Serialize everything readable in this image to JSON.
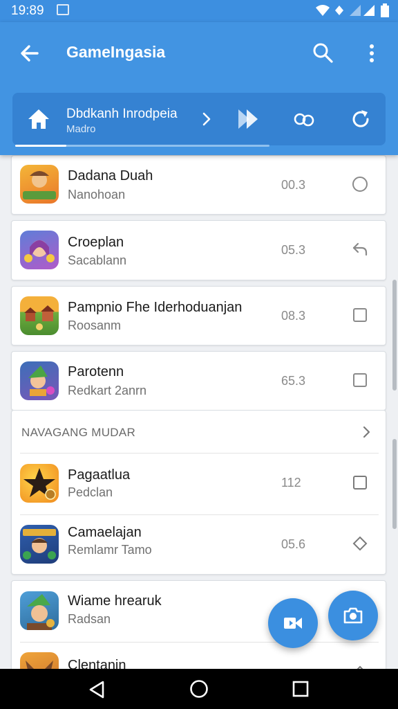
{
  "status_bar": {
    "time": "19:89"
  },
  "app_bar": {
    "title": "GameIngasia"
  },
  "sub_bar": {
    "title": "Dbdkanh Inrodpeia",
    "subtitle": "Madro",
    "progress_fraction": 0.2
  },
  "items": [
    {
      "title": "Dadana Duah",
      "subtitle": "Nanohoan",
      "count": "00.3",
      "control": "radio",
      "icon": "game-adventurer-icon"
    },
    {
      "title": "Croeplan",
      "subtitle": "Sacablann",
      "count": "05.3",
      "control": "reply",
      "icon": "game-girl-icon"
    },
    {
      "title": "Pampnio Fhe Iderhoduanjan",
      "subtitle": "Roosanm",
      "count": "08.3",
      "control": "checkbox",
      "icon": "game-village-icon"
    },
    {
      "title": "Parotenn",
      "subtitle": "Redkart 2anrn",
      "count": "65.3",
      "control": "checkbox",
      "icon": "game-elf-icon"
    }
  ],
  "section": {
    "title": "NAVAGANG MUDAR",
    "items": [
      {
        "title": "Pagaatlua",
        "subtitle": "Pedclan",
        "count": "112",
        "control": "checkbox",
        "icon": "game-star-icon"
      },
      {
        "title": "Camaelajan",
        "subtitle": "Remlamr Tamo",
        "count": "05.6",
        "control": "diamond",
        "icon": "game-knight-icon"
      }
    ]
  },
  "bottom_items": [
    {
      "title": "Wiame hrearuk",
      "subtitle": "Radsan",
      "icon": "game-hero-icon"
    },
    {
      "title": "Clentanin",
      "icon": "game-warrior-icon"
    }
  ],
  "colors": {
    "primary": "#4294e2",
    "primary_dark": "#3582d2",
    "fab": "#3b8fe0"
  }
}
